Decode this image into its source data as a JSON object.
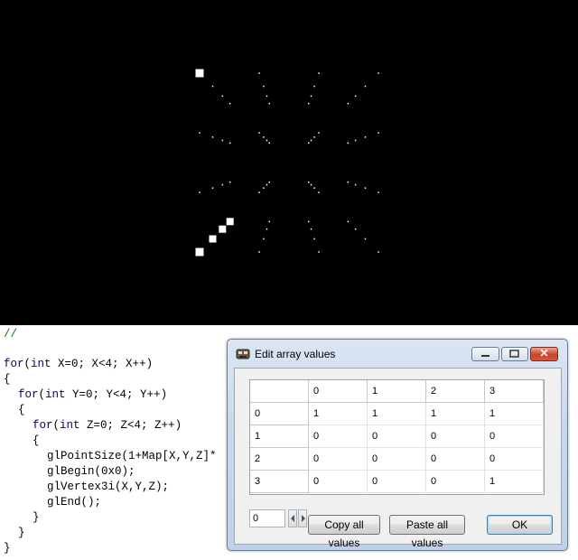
{
  "code_comment": "//",
  "code_lines": [
    {
      "kw": "for",
      "text": "(",
      "kw2": "int",
      "rest": " X=0; X<4; X++)"
    },
    {
      "plain": "{"
    },
    {
      "kw": "for",
      "text": "(",
      "kw2": "int",
      "rest": " Y=0; Y<4; Y++)"
    },
    {
      "plain": "{"
    },
    {
      "kw": "for",
      "text": "(",
      "kw2": "int",
      "rest": " Z=0; Z<4; Z++)"
    },
    {
      "plain": "{"
    },
    {
      "plain": "glPointSize(1+Map[X,Y,Z]*"
    },
    {
      "plain": "glBegin(0x0);"
    },
    {
      "plain": "glVertex3i(X,Y,Z);"
    },
    {
      "plain": "glEnd();"
    },
    {
      "plain": "}"
    },
    {
      "plain": "}"
    },
    {
      "plain": "}"
    }
  ],
  "dialog": {
    "title": "Edit array values",
    "grid": {
      "column_headers": [
        "0",
        "1",
        "2",
        "3"
      ],
      "row_headers": [
        "0",
        "1",
        "2",
        "3"
      ],
      "rows": [
        [
          "1",
          "1",
          "1",
          "1"
        ],
        [
          "0",
          "0",
          "0",
          "0"
        ],
        [
          "0",
          "0",
          "0",
          "0"
        ],
        [
          "0",
          "0",
          "0",
          "1"
        ]
      ]
    },
    "spin_value": "0",
    "copy_label": "Copy all values",
    "paste_label": "Paste all values",
    "ok_label": "OK",
    "close_glyph": "✕"
  }
}
